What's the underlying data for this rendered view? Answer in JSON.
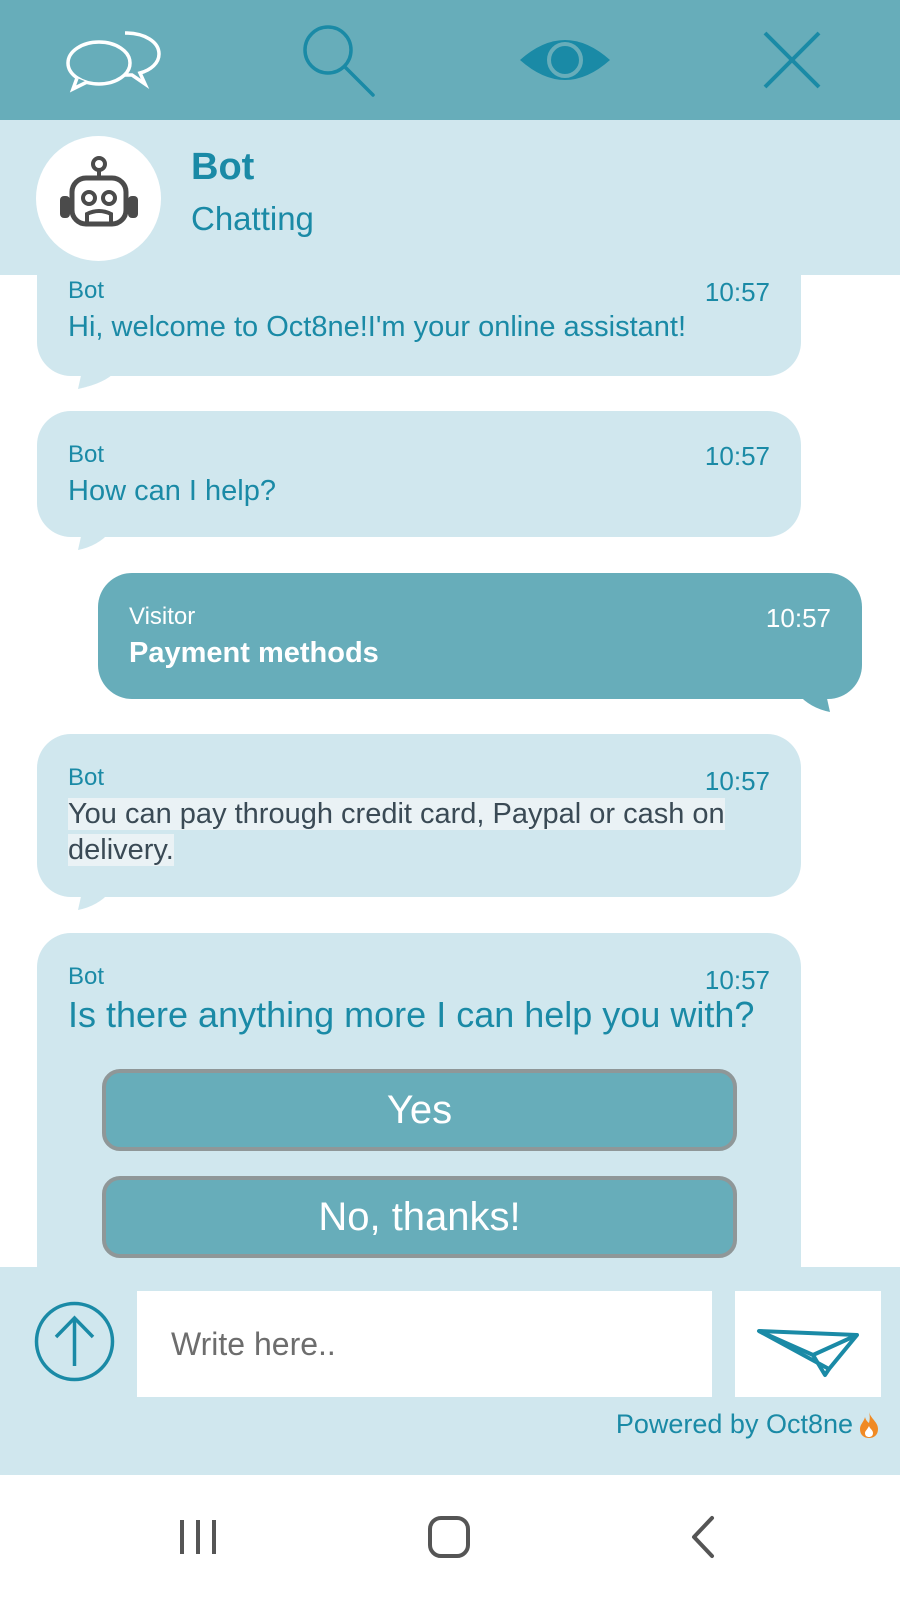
{
  "toolbar": {
    "icons": [
      "chat-bubbles-icon",
      "search-icon",
      "eye-icon",
      "close-icon"
    ]
  },
  "header": {
    "name": "Bot",
    "status": "Chatting",
    "avatar_icon": "robot-icon"
  },
  "messages": [
    {
      "sender": "Bot",
      "time": "10:57",
      "text": "Hi, welcome to Oct8ne!I'm your online assistant!"
    },
    {
      "sender": "Bot",
      "time": "10:57",
      "text": "How can I help?"
    },
    {
      "sender": "Visitor",
      "time": "10:57",
      "text": "Payment methods"
    },
    {
      "sender": "Bot",
      "time": "10:57",
      "text_line1": "You can pay through credit card, Paypal or cash on",
      "text_line2": "delivery."
    },
    {
      "sender": "Bot",
      "time": "10:57",
      "text": "Is there anything more I can help you with?",
      "options": [
        "Yes",
        "No, thanks!"
      ]
    }
  ],
  "composer": {
    "placeholder": "Write here..",
    "powered_by": "Powered by Oct8ne"
  },
  "colors": {
    "toolbar": "#67adba",
    "panel": "#d0e7ee",
    "accent_text": "#1a8aa6",
    "visitor_bubble": "#67adba",
    "button_border": "#8f9798",
    "flame": "#f08a24"
  },
  "navbar": {
    "icons": [
      "recent-apps-icon",
      "home-icon",
      "back-icon"
    ]
  }
}
